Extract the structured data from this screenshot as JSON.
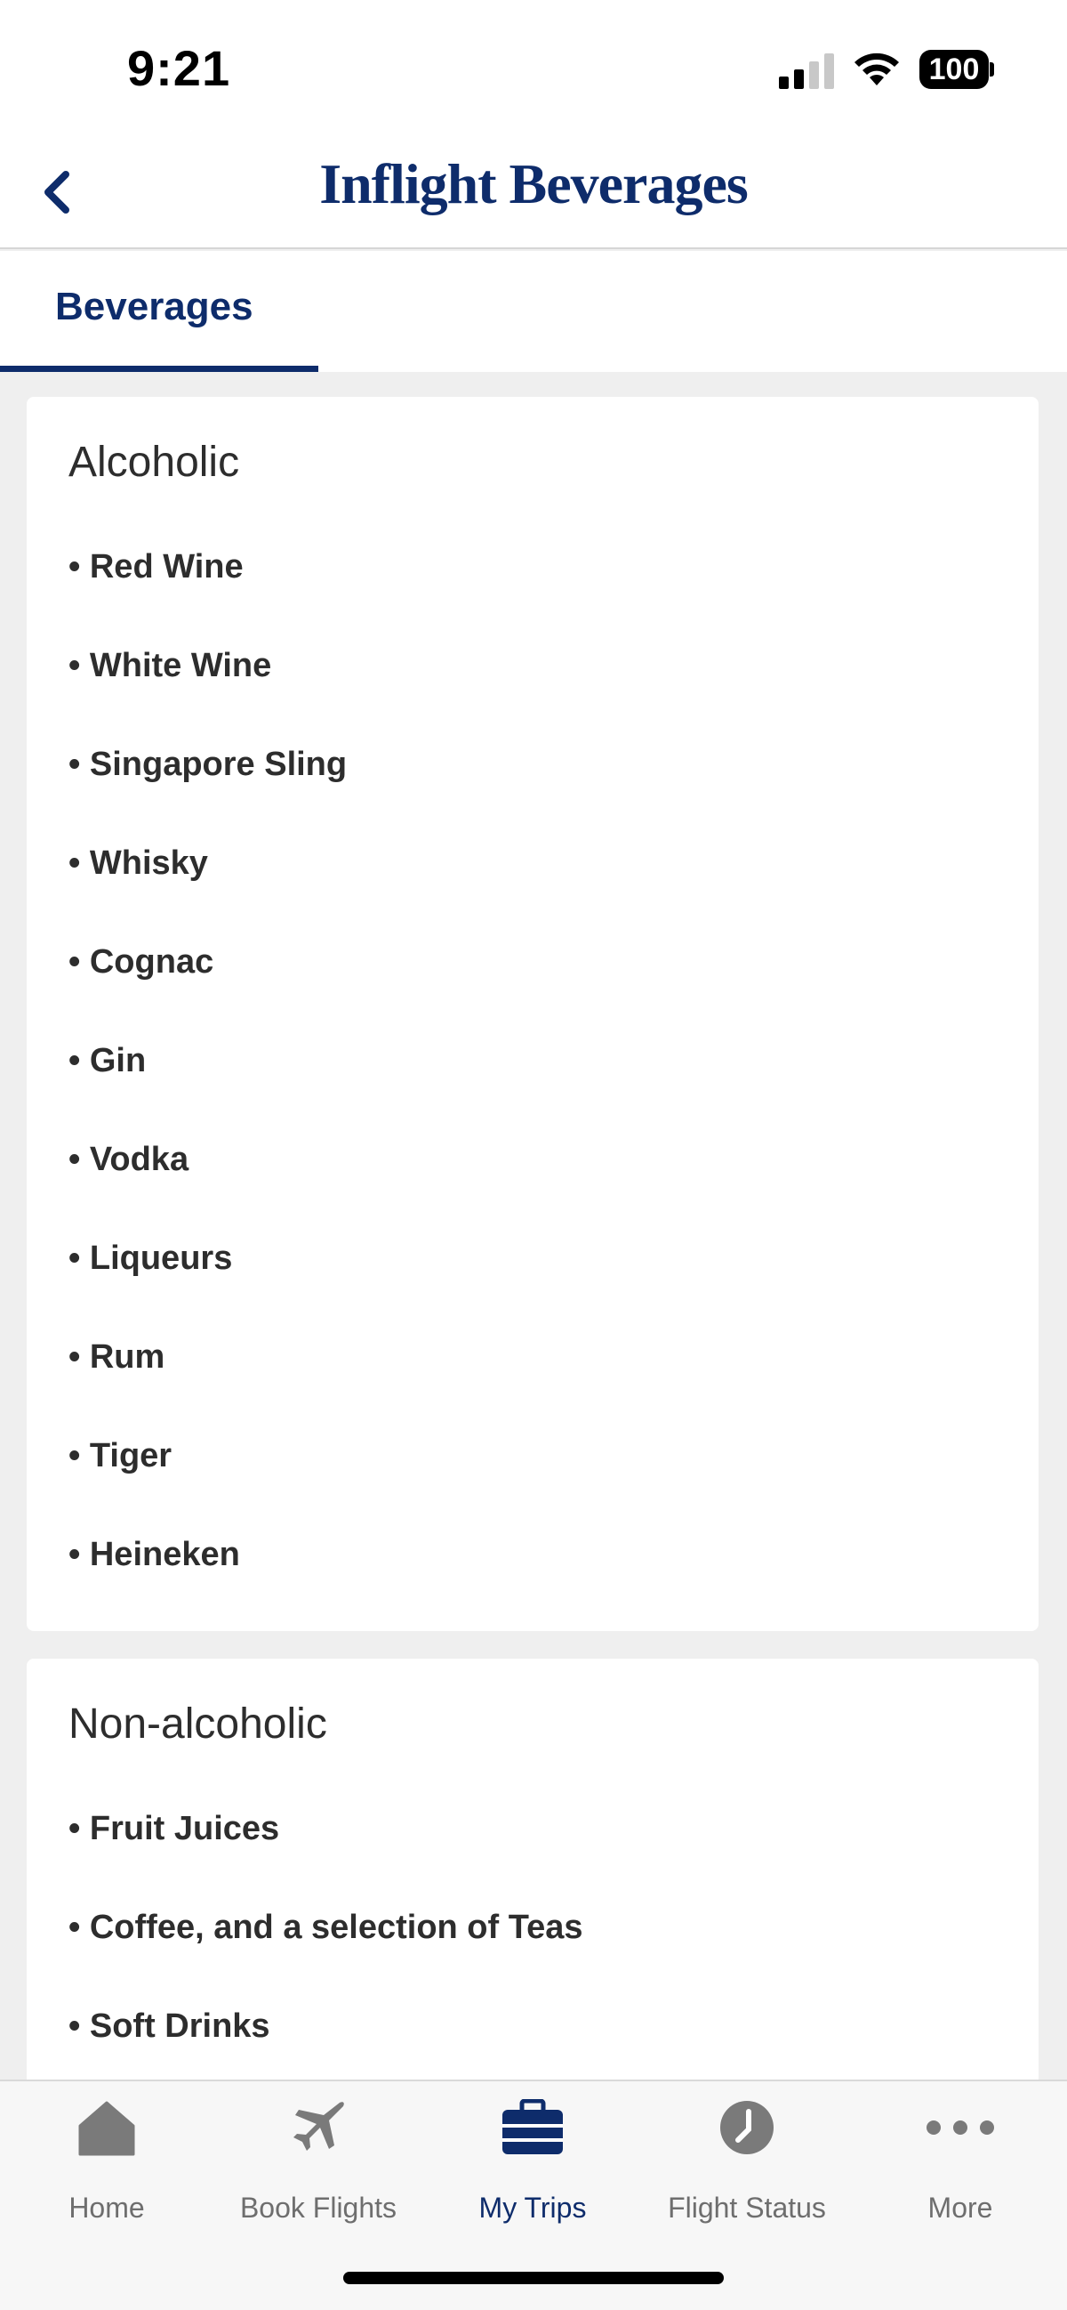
{
  "status_bar": {
    "time": "9:21",
    "battery": "100"
  },
  "header": {
    "title": "Inflight Beverages"
  },
  "tabs": [
    {
      "label": "Beverages"
    }
  ],
  "sections": [
    {
      "heading": "Alcoholic",
      "items": [
        "• Red Wine",
        "• White Wine",
        "• Singapore Sling",
        "• Whisky",
        "• Cognac",
        "• Gin",
        "• Vodka",
        "• Liqueurs",
        "• Rum",
        "• Tiger",
        "• Heineken"
      ]
    },
    {
      "heading": "Non-alcoholic",
      "items": [
        "• Fruit Juices",
        "• Coffee, and a selection of Teas",
        "• Soft Drinks"
      ]
    }
  ],
  "bottom_nav": [
    {
      "label": "Home",
      "icon": "home-icon"
    },
    {
      "label": "Book Flights",
      "icon": "airplane-icon"
    },
    {
      "label": "My Trips",
      "icon": "suitcase-icon",
      "active": true
    },
    {
      "label": "Flight Status",
      "icon": "clock-icon"
    },
    {
      "label": "More",
      "icon": "more-icon"
    }
  ],
  "colors": {
    "brand": "#0e2c6b",
    "inactive": "#6e6e6e",
    "background": "#efefef"
  }
}
